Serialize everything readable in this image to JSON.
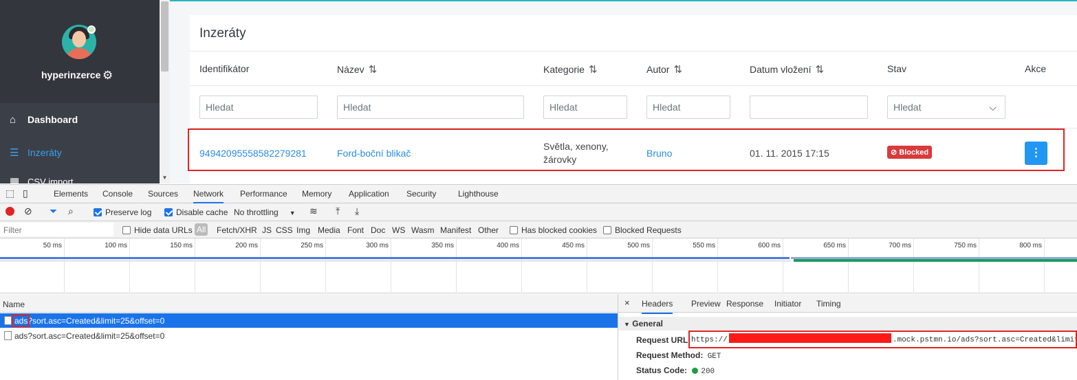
{
  "sidebar": {
    "user_name": "hyperinzerce",
    "items": [
      {
        "label": "Dashboard",
        "icon": "home-icon"
      },
      {
        "label": "Inzeráty",
        "icon": "list-icon"
      },
      {
        "label": "CSV import",
        "icon": "table-icon"
      }
    ]
  },
  "main": {
    "title": "Inzeráty",
    "columns": [
      {
        "label": "Identifikátor",
        "sortable": false
      },
      {
        "label": "Název",
        "sortable": true
      },
      {
        "label": "Kategorie",
        "sortable": true
      },
      {
        "label": "Autor",
        "sortable": true
      },
      {
        "label": "Datum vložení",
        "sortable": true
      },
      {
        "label": "Stav",
        "sortable": false
      },
      {
        "label": "Akce",
        "sortable": false
      }
    ],
    "filters": {
      "placeholder": "Hledat",
      "state_select": "Hledat"
    },
    "row": {
      "id": "94942095558582279281",
      "name": "Ford-boční blikač",
      "category_line1": "Světla, xenony,",
      "category_line2": "žárovky",
      "author": "Bruno",
      "date": "01. 11. 2015 17:15",
      "status": "Blocked"
    }
  },
  "devtools": {
    "tabs": [
      "Elements",
      "Console",
      "Sources",
      "Network",
      "Performance",
      "Memory",
      "Application",
      "Security",
      "Lighthouse"
    ],
    "active_tab": "Network",
    "toolbar": {
      "preserve_log": "Preserve log",
      "disable_cache": "Disable cache",
      "throttling": "No throttling"
    },
    "filter_bar": {
      "placeholder": "Filter",
      "hide_data_urls": "Hide data URLs",
      "all": "All",
      "types": [
        "Fetch/XHR",
        "JS",
        "CSS",
        "Img",
        "Media",
        "Font",
        "Doc",
        "WS",
        "Wasm",
        "Manifest",
        "Other"
      ],
      "has_blocked_cookies": "Has blocked cookies",
      "blocked_requests": "Blocked Requests"
    },
    "timeline_ticks": [
      "50 ms",
      "100 ms",
      "150 ms",
      "200 ms",
      "250 ms",
      "300 ms",
      "350 ms",
      "400 ms",
      "450 ms",
      "500 ms",
      "550 ms",
      "600 ms",
      "650 ms",
      "700 ms",
      "750 ms",
      "800 ms"
    ],
    "requests_header": "Name",
    "requests": [
      {
        "prefix": "ads",
        "rest": "?sort.asc=Created&limit=25&offset=0"
      },
      {
        "prefix": "ads",
        "rest": "?sort.asc=Created&limit=25&offset=0"
      }
    ],
    "details": {
      "close": "×",
      "tabs": [
        "Headers",
        "Preview",
        "Response",
        "Initiator",
        "Timing"
      ],
      "active_tab": "Headers",
      "section": "General",
      "request_url_label": "Request URL:",
      "request_url_start": "https://",
      "request_url_end": ".mock.pstmn.io/ads?sort.asc=Created&limit",
      "request_method_label": "Request Method:",
      "request_method": "GET",
      "status_code_label": "Status Code:",
      "status_code": "200"
    }
  }
}
